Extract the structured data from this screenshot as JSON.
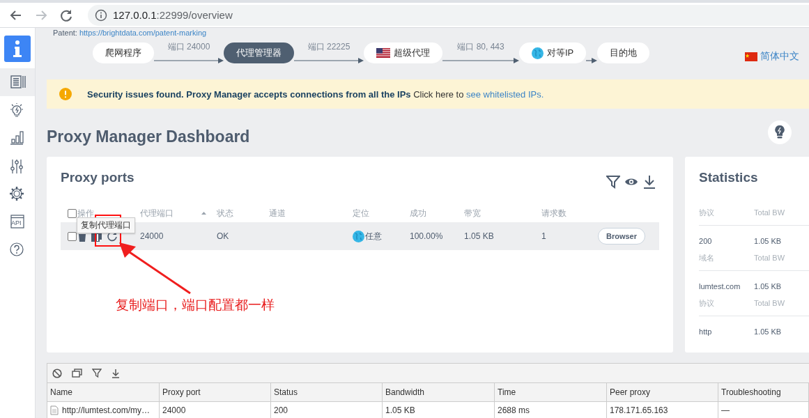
{
  "browser": {
    "url_host": "127.0.0.1",
    "url_path": ":22999/overview"
  },
  "sidebar": {
    "items": [
      {
        "kind": "list",
        "selected": true
      },
      {
        "kind": "bulb",
        "selected": false
      },
      {
        "kind": "chart",
        "selected": false
      },
      {
        "kind": "sliders",
        "selected": false
      },
      {
        "kind": "gear",
        "selected": false
      },
      {
        "kind": "api",
        "label": "API",
        "selected": false
      },
      {
        "kind": "help",
        "selected": false
      }
    ]
  },
  "patent": {
    "label": "Patent:",
    "link": "https://brightdata.com/patent-marking"
  },
  "flow": {
    "nodes": [
      {
        "label": "爬网程序",
        "kind": "plain",
        "selected": false
      },
      {
        "label": "代理管理器",
        "kind": "plain",
        "selected": true
      },
      {
        "label": "超级代理",
        "kind": "flag",
        "selected": false
      },
      {
        "label": "对等IP",
        "kind": "globe",
        "selected": false
      },
      {
        "label": "目的地",
        "kind": "plain",
        "selected": false
      }
    ],
    "edges": [
      "端口 24000",
      "端口 22225",
      "端口 80, 443"
    ]
  },
  "language": "简体中文",
  "alert": {
    "message": "**Security issues found. Proxy Manager accepts connections from all the IPs** Click here to ",
    "link": "see whitelisted IPs."
  },
  "title": "Proxy Manager Dashboard",
  "proxy_ports": {
    "title": "Proxy ports",
    "all_checked": false,
    "columns": [
      "操作",
      "代理端口",
      "状态",
      "通道",
      "定位",
      "成功",
      "带宽",
      "请求数"
    ],
    "rows": [
      {
        "checked": false,
        "port": "24000",
        "status": "OK",
        "location": "任意",
        "success": "100.00%",
        "bandwidth": "1.05 KB",
        "requests": "1",
        "button": "Browser"
      }
    ],
    "tooltip": "复制代理端口"
  },
  "statistics": {
    "title": "Statistics",
    "groups": [
      {
        "header": [
          "协议",
          "Total BW"
        ],
        "rows": [
          [
            "200",
            "1.05 KB"
          ]
        ]
      },
      {
        "header": [
          "域名",
          "Total BW"
        ],
        "rows": [
          [
            "lumtest.com",
            "1.05 KB"
          ]
        ]
      },
      {
        "header": [
          "协议",
          "Total BW"
        ],
        "rows": [
          [
            "http",
            "1.05 KB"
          ]
        ]
      }
    ]
  },
  "annotation": "复制端口，端口配置都一样",
  "requests": {
    "columns": [
      "Name",
      "Proxy port",
      "Status",
      "Bandwidth",
      "Time",
      "Peer proxy",
      "Troubleshooting"
    ],
    "rows": [
      [
        "http://lumtest.com/my…",
        "24000",
        "200",
        "1.05 KB",
        "2688 ms",
        "178.171.65.163",
        "—"
      ]
    ]
  }
}
